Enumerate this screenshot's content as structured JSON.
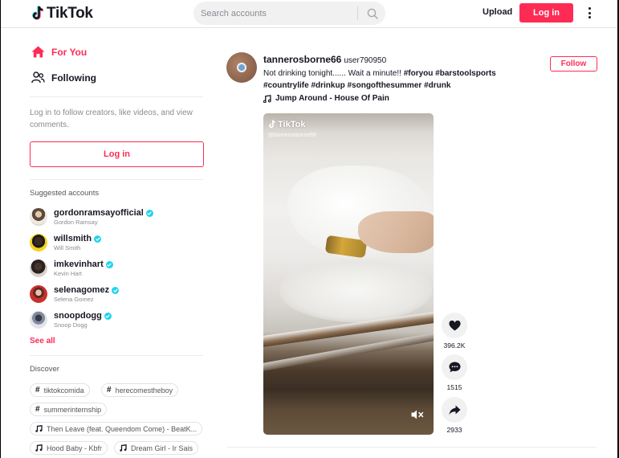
{
  "header": {
    "logo_text": "TikTok",
    "search_placeholder": "Search accounts",
    "upload_label": "Upload",
    "login_label": "Log in"
  },
  "sidebar": {
    "nav": [
      {
        "label": "For You",
        "icon": "home-icon",
        "active": true
      },
      {
        "label": "Following",
        "icon": "users-icon",
        "active": false
      }
    ],
    "login_hint": "Log in to follow creators, like videos, and view comments.",
    "login_label": "Log in",
    "suggested_title": "Suggested accounts",
    "accounts": [
      {
        "handle": "gordonramsayofficial",
        "name": "Gordon Ramsay",
        "verified": true
      },
      {
        "handle": "willsmith",
        "name": "Will Smith",
        "verified": true
      },
      {
        "handle": "imkevinhart",
        "name": "Kevin Hart",
        "verified": true
      },
      {
        "handle": "selenagomez",
        "name": "Selena Gomez",
        "verified": true
      },
      {
        "handle": "snoopdogg",
        "name": "Snoop Dogg",
        "verified": true
      }
    ],
    "see_all_label": "See all",
    "discover_title": "Discover",
    "discover": [
      {
        "type": "hashtag",
        "label": "tiktokcomida"
      },
      {
        "type": "hashtag",
        "label": "herecomestheboy"
      },
      {
        "type": "hashtag",
        "label": "summerinternship"
      },
      {
        "type": "music",
        "label": "Then Leave (feat. Queendom Come) - BeatK..."
      },
      {
        "type": "music",
        "label": "Hood Baby - Kbfr"
      },
      {
        "type": "music",
        "label": "Dream Girl - Ir Sais"
      }
    ]
  },
  "post": {
    "handle": "tannerosborne66",
    "nickname": "user790950",
    "caption_text": "Not drinking tonight...... Wait a minute!!",
    "hashtags": [
      "#foryou",
      "#barstoolsports",
      "#countrylife",
      "#drinkup",
      "#songofthesummer",
      "#drunk"
    ],
    "music": "Jump Around - House Of Pain",
    "follow_label": "Follow",
    "video": {
      "watermark": "TikTok",
      "watermark_user": "@tannerosborne66",
      "muted": true
    },
    "likes": "396.2K",
    "comments": "1515",
    "shares": "2933"
  },
  "colors": {
    "brand": "#fe2c55",
    "verified": "#20d5ec",
    "text": "#161823",
    "muted_text": "#8a8b91"
  }
}
